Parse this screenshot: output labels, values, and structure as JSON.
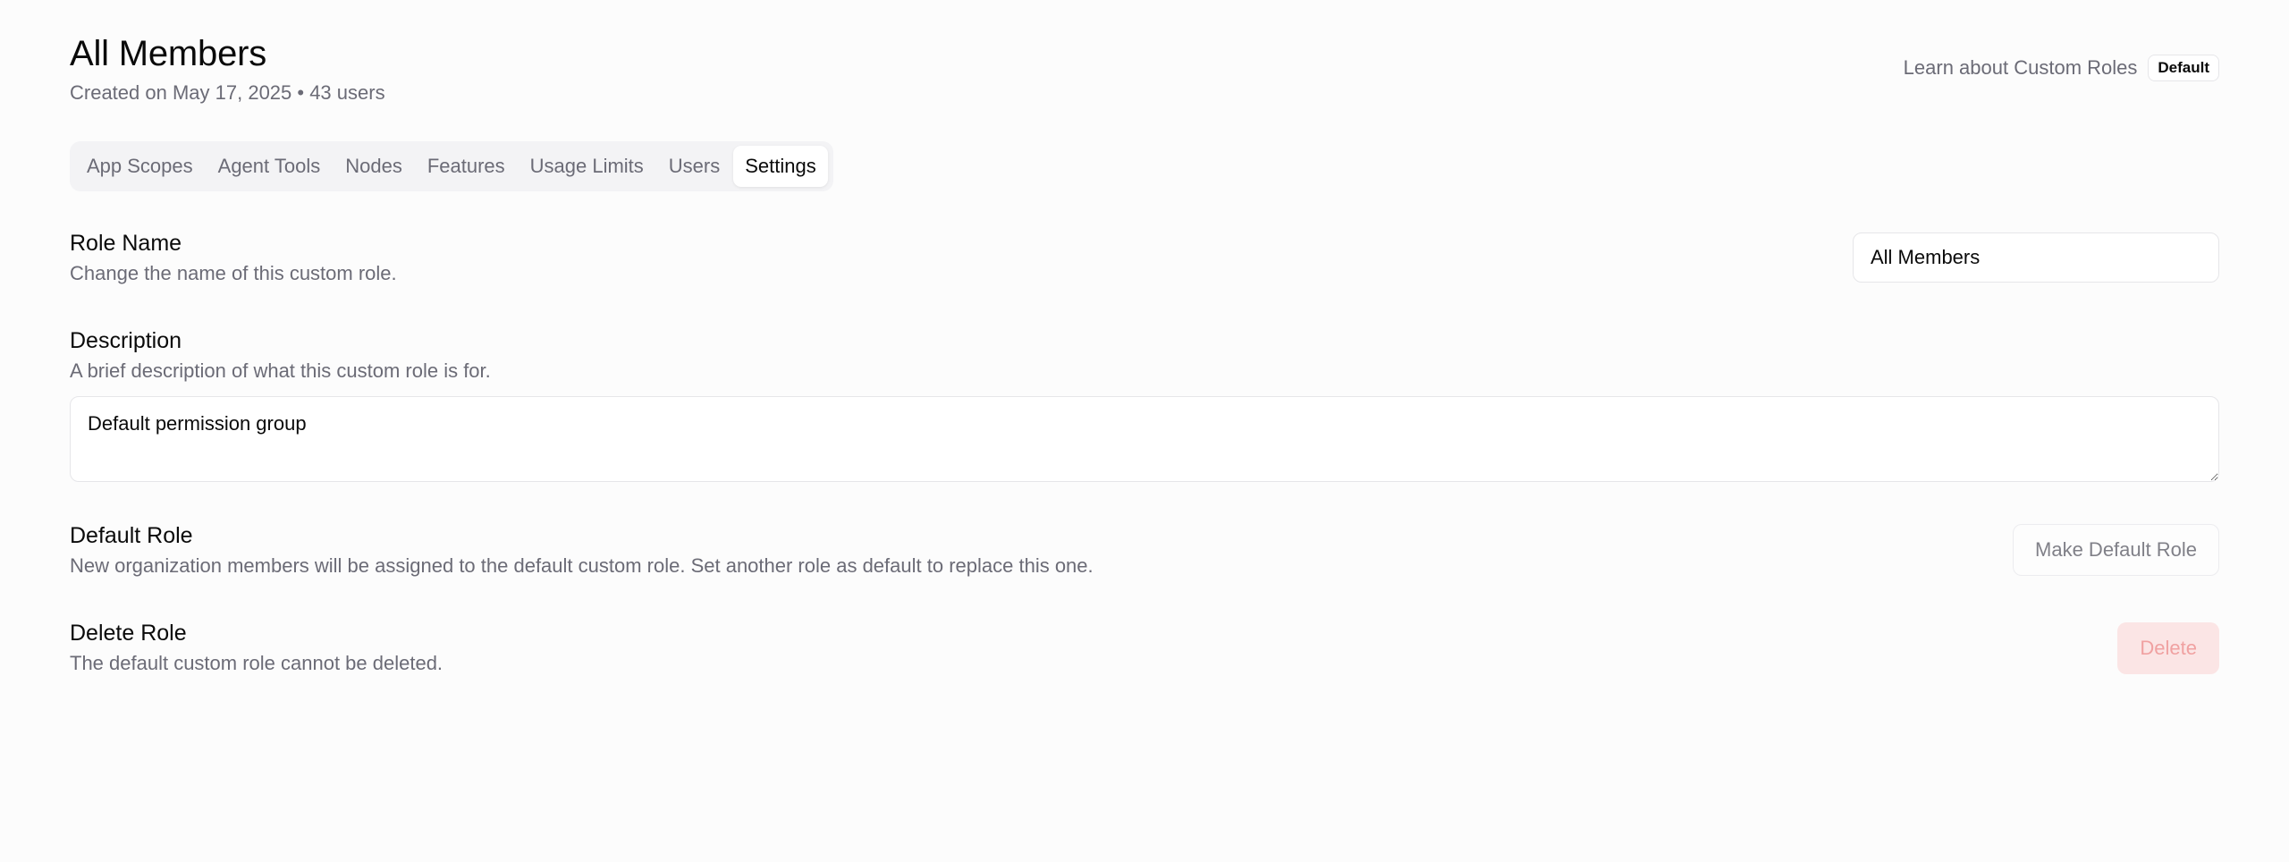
{
  "header": {
    "title": "All Members",
    "subtitle": "Created on May 17, 2025 • 43 users",
    "learn_link": "Learn about Custom Roles",
    "badge": "Default"
  },
  "tabs": [
    {
      "label": "App Scopes",
      "active": false
    },
    {
      "label": "Agent Tools",
      "active": false
    },
    {
      "label": "Nodes",
      "active": false
    },
    {
      "label": "Features",
      "active": false
    },
    {
      "label": "Usage Limits",
      "active": false
    },
    {
      "label": "Users",
      "active": false
    },
    {
      "label": "Settings",
      "active": true
    }
  ],
  "role_name": {
    "title": "Role Name",
    "description": "Change the name of this custom role.",
    "value": "All Members"
  },
  "description": {
    "title": "Description",
    "description": "A brief description of what this custom role is for.",
    "value": "Default permission group"
  },
  "default_role": {
    "title": "Default Role",
    "description": "New organization members will be assigned to the default custom role. Set another role as default to replace this one.",
    "button": "Make Default Role"
  },
  "delete_role": {
    "title": "Delete Role",
    "description": "The default custom role cannot be deleted.",
    "button": "Delete"
  },
  "colors": {
    "background": "#fcfcfc",
    "muted_text": "#6b6b76",
    "delete_bg": "#fbe5e5",
    "delete_text": "#f0a1a1"
  }
}
